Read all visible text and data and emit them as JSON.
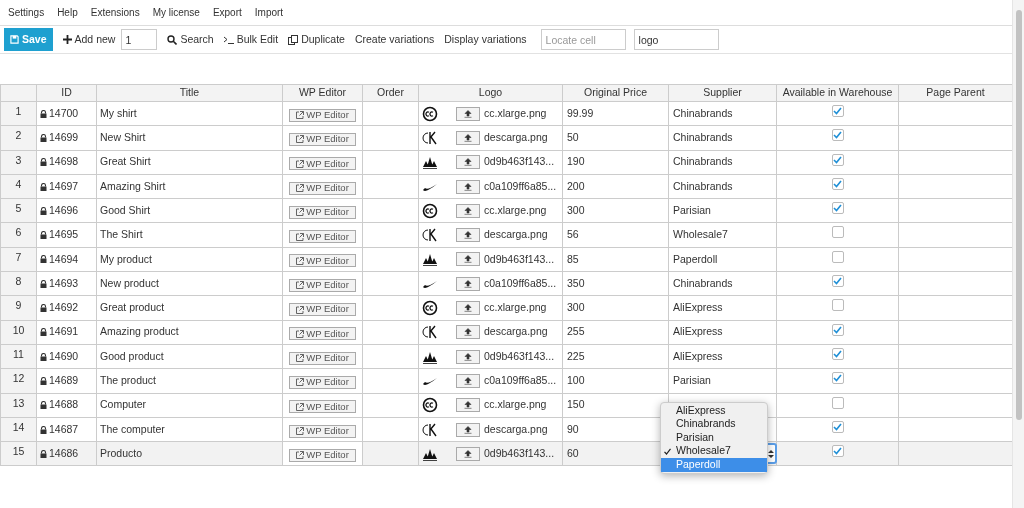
{
  "menu": [
    "Settings",
    "Help",
    "Extensions",
    "My license",
    "Export",
    "Import"
  ],
  "toolbar": {
    "save": "Save",
    "add_new": "Add new",
    "quantity": "1",
    "search": "Search",
    "bulk_edit": "Bulk Edit",
    "duplicate": "Duplicate",
    "create_variations": "Create variations",
    "display_variations": "Display variations",
    "locate_cell": {
      "placeholder": "Locate cell"
    },
    "filter": {
      "value": "logo"
    }
  },
  "table": {
    "columns": [
      "ID",
      "Title",
      "WP Editor",
      "Order",
      "Logo",
      "Original Price",
      "Supplier",
      "Available in Warehouse",
      "Page Parent"
    ],
    "rows": [
      {
        "num": "1",
        "id": "14700",
        "title": "My shirt",
        "editor": "WP Editor",
        "kind": "cc",
        "file": "cc.xlarge.png",
        "price": "99.99",
        "supplier": "Chinabrands",
        "available": true,
        "highlighted": false
      },
      {
        "num": "2",
        "id": "14699",
        "title": "New Shirt",
        "editor": "WP Editor",
        "kind": "ck",
        "file": "descarga.png",
        "price": "50",
        "supplier": "Chinabrands",
        "available": true,
        "highlighted": false
      },
      {
        "num": "3",
        "id": "14698",
        "title": "Great Shirt",
        "editor": "WP Editor",
        "kind": "trefoil",
        "file": "0d9b463f143...",
        "price": "190",
        "supplier": "Chinabrands",
        "available": true,
        "highlighted": false
      },
      {
        "num": "4",
        "id": "14697",
        "title": "Amazing Shirt",
        "editor": "WP Editor",
        "kind": "swoosh",
        "file": "c0a109ff6a85...",
        "price": "200",
        "supplier": "Chinabrands",
        "available": true,
        "highlighted": false
      },
      {
        "num": "5",
        "id": "14696",
        "title": "Good Shirt",
        "editor": "WP Editor",
        "kind": "cc",
        "file": "cc.xlarge.png",
        "price": "300",
        "supplier": "Parisian",
        "available": true,
        "highlighted": false
      },
      {
        "num": "6",
        "id": "14695",
        "title": "The Shirt",
        "editor": "WP Editor",
        "kind": "ck",
        "file": "descarga.png",
        "price": "56",
        "supplier": "Wholesale7",
        "available": false,
        "highlighted": false
      },
      {
        "num": "7",
        "id": "14694",
        "title": "My product",
        "editor": "WP Editor",
        "kind": "trefoil",
        "file": "0d9b463f143...",
        "price": "85",
        "supplier": "Paperdoll",
        "available": false,
        "highlighted": false
      },
      {
        "num": "8",
        "id": "14693",
        "title": "New product",
        "editor": "WP Editor",
        "kind": "swoosh",
        "file": "c0a109ff6a85...",
        "price": "350",
        "supplier": "Chinabrands",
        "available": true,
        "highlighted": false
      },
      {
        "num": "9",
        "id": "14692",
        "title": "Great product",
        "editor": "WP Editor",
        "kind": "cc",
        "file": "cc.xlarge.png",
        "price": "300",
        "supplier": "AliExpress",
        "available": false,
        "highlighted": false
      },
      {
        "num": "10",
        "id": "14691",
        "title": "Amazing product",
        "editor": "WP Editor",
        "kind": "ck",
        "file": "descarga.png",
        "price": "255",
        "supplier": "AliExpress",
        "available": true,
        "highlighted": false
      },
      {
        "num": "11",
        "id": "14690",
        "title": "Good product",
        "editor": "WP Editor",
        "kind": "trefoil",
        "file": "0d9b463f143...",
        "price": "225",
        "supplier": "AliExpress",
        "available": true,
        "highlighted": false
      },
      {
        "num": "12",
        "id": "14689",
        "title": "The product",
        "editor": "WP Editor",
        "kind": "swoosh",
        "file": "c0a109ff6a85...",
        "price": "100",
        "supplier": "Parisian",
        "available": true,
        "highlighted": false
      },
      {
        "num": "13",
        "id": "14688",
        "title": "Computer",
        "editor": "WP Editor",
        "kind": "cc",
        "file": "cc.xlarge.png",
        "price": "150",
        "available": false,
        "highlighted": false
      },
      {
        "num": "14",
        "id": "14687",
        "title": "The computer",
        "editor": "WP Editor",
        "kind": "ck",
        "file": "descarga.png",
        "price": "90",
        "available": true,
        "highlighted": false
      },
      {
        "num": "15",
        "id": "14686",
        "title": "Producto",
        "editor": "WP Editor",
        "kind": "trefoil",
        "file": "0d9b463f143...",
        "price": "60",
        "available": true,
        "highlighted": true,
        "editing": true
      }
    ]
  },
  "dropdown": {
    "options": [
      {
        "label": "AliExpress",
        "selected": false,
        "highlighted": false
      },
      {
        "label": "Chinabrands",
        "selected": false,
        "highlighted": false
      },
      {
        "label": "Parisian",
        "selected": false,
        "highlighted": false
      },
      {
        "label": "Wholesale7",
        "selected": true,
        "highlighted": false
      },
      {
        "label": "Paperdoll",
        "selected": false,
        "highlighted": true
      }
    ]
  }
}
